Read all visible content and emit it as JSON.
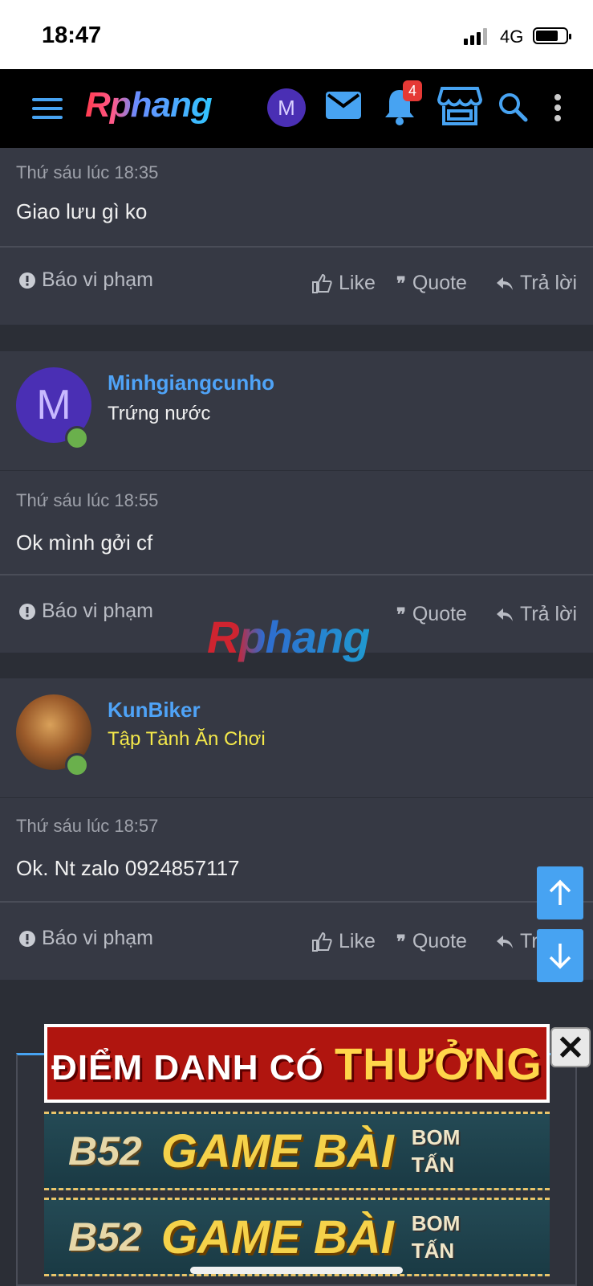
{
  "status_bar": {
    "time": "18:47",
    "network": "4G"
  },
  "navbar": {
    "logo": "Rphang",
    "avatar_letter": "M",
    "notification_count": "4"
  },
  "posts": [
    {
      "time": "Thứ sáu lúc 18:35",
      "content": "Giao lưu gì ko",
      "report": "Báo vi phạm",
      "like": "Like",
      "quote": "Quote",
      "reply": "Trả lời"
    },
    {
      "username": "Minhgiangcunho",
      "user_title": "Trứng nước",
      "avatar_letter": "M",
      "time": "Thứ sáu lúc 18:55",
      "content": "Ok mình gởi cf",
      "report": "Báo vi phạm",
      "quote": "Quote",
      "reply": "Trả lời"
    },
    {
      "username": "KunBiker",
      "user_title": "Tập Tành Ăn Chơi",
      "time": "Thứ sáu lúc 18:57",
      "content": "Ok. Nt zalo 0924857117",
      "report": "Báo vi phạm",
      "like": "Like",
      "quote": "Quote",
      "reply": "Tr"
    }
  ],
  "watermark": "Rphang",
  "ads": {
    "banner1_part1": "ĐIỂM DANH CÓ",
    "banner1_part2": "THƯỞNG",
    "banner2_brand": "B52",
    "banner2_title": "GAME BÀI",
    "banner2_sub1": "BOM",
    "banner2_sub2": "TẤN",
    "close": "✕"
  },
  "colors": {
    "accent": "#47a3f2",
    "username": "#4fa3f7",
    "title_yellow": "#f5e94a",
    "online": "#6ab04c"
  }
}
